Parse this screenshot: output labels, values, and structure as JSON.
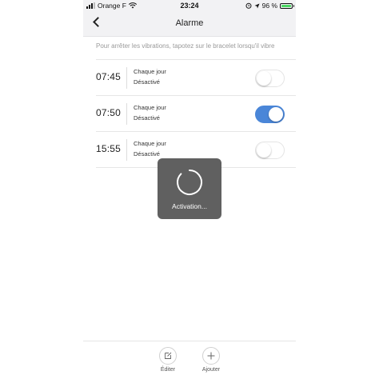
{
  "status_bar": {
    "carrier": "Orange F",
    "time": "23:24",
    "battery_percent": "96 %"
  },
  "nav": {
    "title": "Alarme"
  },
  "hint": "Pour arrêter les vibrations, tapotez sur le bracelet lorsqu'il vibre",
  "alarms": [
    {
      "time": "07:45",
      "repeat": "Chaque jour",
      "state": "Désactivé",
      "enabled": false
    },
    {
      "time": "07:50",
      "repeat": "Chaque jour",
      "state": "Désactivé",
      "enabled": true
    },
    {
      "time": "15:55",
      "repeat": "Chaque jour",
      "state": "Désactivé",
      "enabled": false
    }
  ],
  "overlay": {
    "label": "Activation..."
  },
  "toolbar": {
    "edit_label": "Éditer",
    "add_label": "Ajouter"
  },
  "colors": {
    "accent": "#4a86d8",
    "battery": "#4cd964"
  }
}
